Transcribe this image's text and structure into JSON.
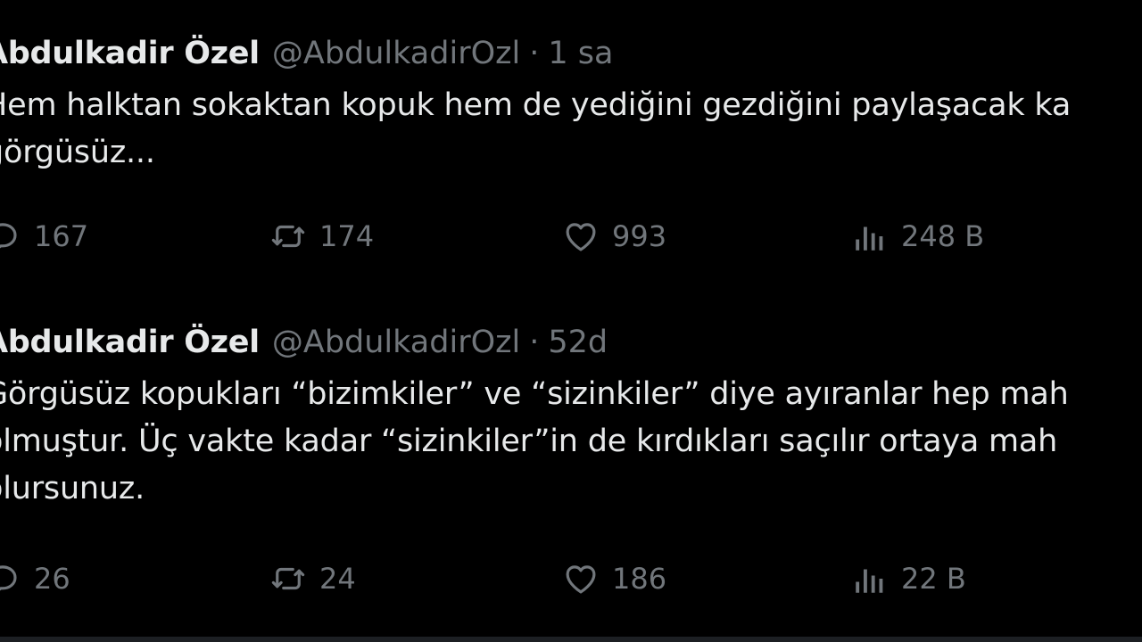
{
  "tweets": [
    {
      "author_name": "Abdulkadir Özel",
      "handle": "@AbdulkadirOzl",
      "separator": "·",
      "time": "1 sa",
      "text": "Hem halktan sokaktan kopuk hem de yediğini gezdiğini paylaşacak ka\ngörgüsüz...",
      "replies": "167",
      "retweets": "174",
      "likes": "993",
      "views": "248 B"
    },
    {
      "author_name": "Abdulkadir Özel",
      "handle": "@AbdulkadirOzl",
      "separator": "·",
      "time": "52d",
      "text": "Görgüsüz kopukları “bizimkiler” ve “sizinkiler” diye ayıranlar hep mah\nolmuştur. Üç vakte kadar “sizinkiler”in de kırdıkları saçılır ortaya mah\nolursunuz.",
      "replies": "26",
      "retweets": "24",
      "likes": "186",
      "views": "22 B"
    }
  ],
  "icons": {
    "reply": "reply-icon",
    "retweet": "retweet-icon",
    "like": "heart-icon",
    "views": "analytics-icon"
  },
  "colors": {
    "background": "#000000",
    "primary_text": "#e7e9ea",
    "secondary_text": "#71767b"
  }
}
